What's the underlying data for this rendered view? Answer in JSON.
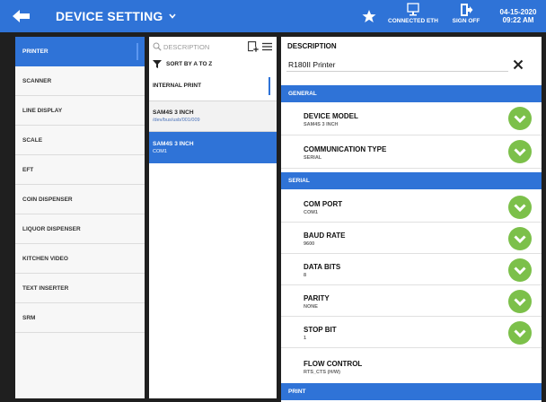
{
  "header": {
    "title": "DEVICE SETTING",
    "connection_label": "CONNECTED ETH",
    "signoff_label": "SIGN OFF",
    "date": "04-15-2020",
    "time": "09:22 AM"
  },
  "categories": [
    {
      "label": "PRINTER",
      "selected": true
    },
    {
      "label": "SCANNER"
    },
    {
      "label": "LINE DISPLAY"
    },
    {
      "label": "SCALE"
    },
    {
      "label": "EFT"
    },
    {
      "label": "COIN DISPENSER"
    },
    {
      "label": "LIQUOR DISPENSER"
    },
    {
      "label": "KITCHEN VIDEO"
    },
    {
      "label": "TEXT INSERTER"
    },
    {
      "label": "SRM"
    }
  ],
  "device_list": {
    "search_placeholder": "DESCRIPTION",
    "sort_label": "SORT BY A TO Z",
    "devices": [
      {
        "name": "INTERNAL PRINT",
        "sub": ""
      },
      {
        "name": "SAM4S 3 INCH",
        "sub": "/dev/bus/usb/001/009"
      },
      {
        "name": "SAM4S 3 INCH",
        "sub": "COM1",
        "selected": true
      }
    ]
  },
  "detail": {
    "description_label": "DESCRIPTION",
    "description_value": "R180II Printer",
    "sections": {
      "general": "GENERAL",
      "serial": "SERIAL",
      "print": "PRINT"
    },
    "device_model": {
      "label": "DEVICE MODEL",
      "value": "SAM4S 3 INCH"
    },
    "communication_type": {
      "label": "COMMUNICATION TYPE",
      "value": "SERIAL"
    },
    "com_port": {
      "label": "COM PORT",
      "value": "COM1"
    },
    "baud_rate": {
      "label": "BAUD RATE",
      "value": "9600"
    },
    "data_bits": {
      "label": "DATA BITS",
      "value": "8"
    },
    "parity": {
      "label": "PARITY",
      "value": "NONE"
    },
    "stop_bit": {
      "label": "STOP BIT",
      "value": "1"
    },
    "flow_control": {
      "label": "FLOW CONTROL",
      "value": "RTS_CTS (H/W)"
    }
  },
  "colors": {
    "accent": "#2f73d7",
    "chevron_green": "#7cc04a",
    "background": "#1f1f1f"
  }
}
